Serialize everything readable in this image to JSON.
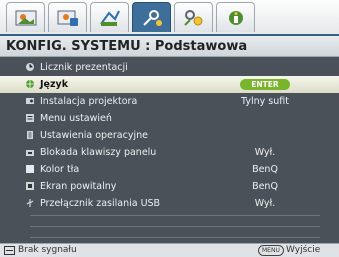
{
  "tabs": [
    {
      "name": "picture-icon"
    },
    {
      "name": "image-settings-icon"
    },
    {
      "name": "source-icon"
    },
    {
      "name": "system-setup-icon"
    },
    {
      "name": "advanced-setup-icon"
    },
    {
      "name": "information-icon"
    }
  ],
  "header": {
    "title": "KONFIG. SYSTEMU : Podstawowa"
  },
  "items": [
    {
      "label": "Licznik prezentacji",
      "value": ""
    },
    {
      "label": "Język",
      "value": ""
    },
    {
      "label": "Instalacja projektora",
      "value": "Tylny sufit"
    },
    {
      "label": "Menu ustawień",
      "value": ""
    },
    {
      "label": "Ustawienia operacyjne",
      "value": ""
    },
    {
      "label": "Blokada klawiszy panelu",
      "value": "Wył."
    },
    {
      "label": "Kolor tła",
      "value": "BenQ"
    },
    {
      "label": "Ekran powitalny",
      "value": "BenQ"
    },
    {
      "label": "Przełącznik zasilania USB",
      "value": "Wył."
    }
  ],
  "enter_badge": "ENTER",
  "footer": {
    "source": "Brak sygnału",
    "menu_key": "MENU",
    "exit": "Wyjście"
  },
  "colors": {
    "accent": "#3e6f9b",
    "panel": "#4a5158",
    "selected": "#eeeedd",
    "enter": "#78b42c"
  }
}
